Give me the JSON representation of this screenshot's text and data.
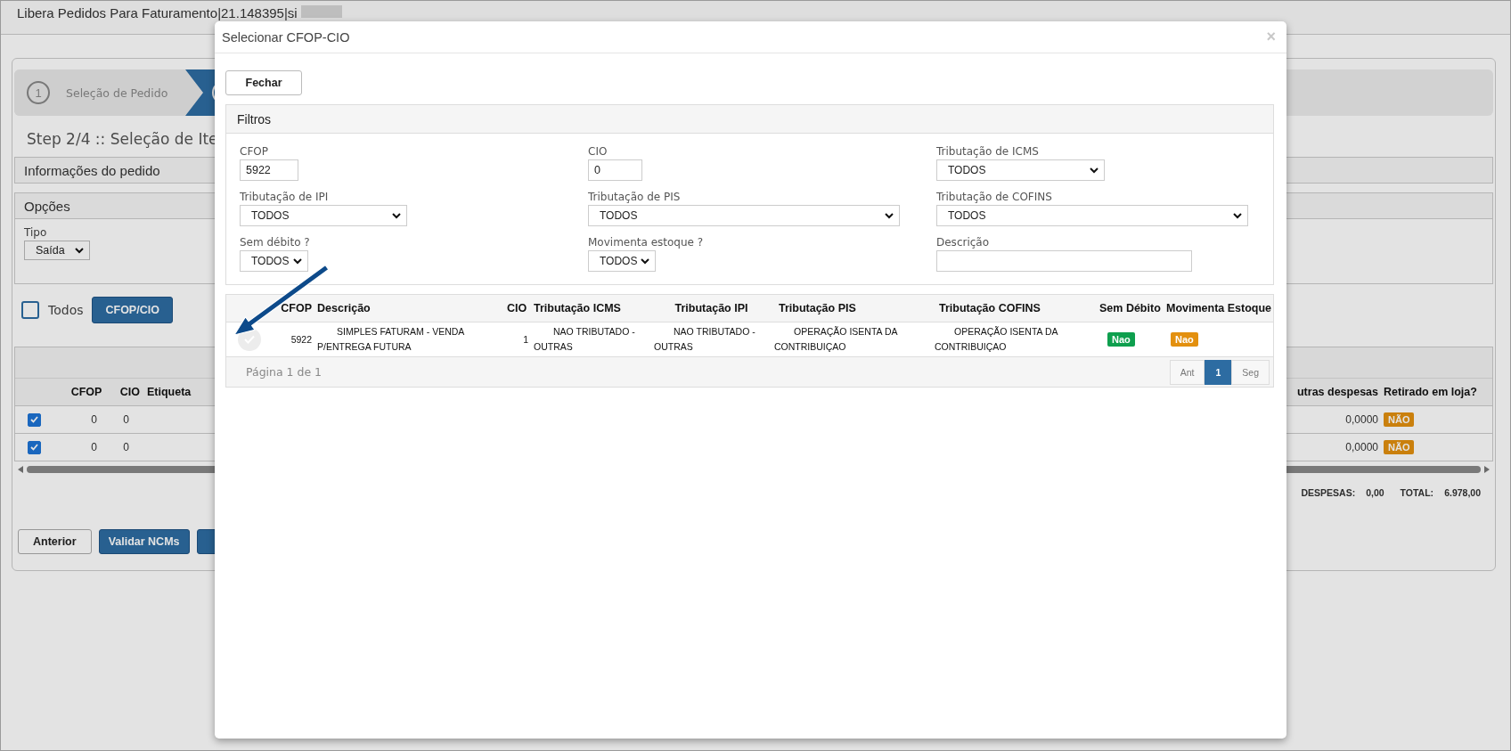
{
  "page": {
    "title": "Libera Pedidos Para Faturamento|21.148395|si"
  },
  "stepper": [
    {
      "number": "1",
      "label": "Seleção de Pedido",
      "selected": false
    },
    {
      "selected": true
    }
  ],
  "step_title": "Step 2/4 :: Seleção de Ite",
  "info_panel": {
    "title": "Informações do pedido"
  },
  "options_panel": {
    "title": "Opções",
    "tipo_label": "Tipo",
    "tipo_value": "Saída"
  },
  "select_all": {
    "label": "Todos",
    "checked": false
  },
  "cfop_button": "CFOP/CIO",
  "items_table": {
    "left_columns": [
      "CFOP",
      "CIO",
      "Etiqueta"
    ],
    "right_columns": [
      "utras despesas",
      "Retirado em loja?"
    ],
    "rows": [
      {
        "checked": true,
        "cfop": "0",
        "cio": "0",
        "outras_despesas": "0,0000",
        "retirado": "NÃO"
      },
      {
        "checked": true,
        "cfop": "0",
        "cio": "0",
        "outras_despesas": "0,0000",
        "retirado": "NÃO"
      }
    ]
  },
  "totals": [
    {
      "label": "DESPESAS:",
      "value": "0,00"
    },
    {
      "label": "TOTAL:",
      "value": "6.978,00"
    }
  ],
  "buttons": [
    {
      "label": "Anterior",
      "kind": "default"
    },
    {
      "label": "Validar NCMs",
      "kind": "primary"
    },
    {
      "kind": "primary"
    }
  ],
  "modal": {
    "title": "Selecionar CFOP-CIO",
    "close": "×",
    "close_button": "Fechar",
    "filters": {
      "title": "Filtros",
      "fields": [
        {
          "label": "CFOP",
          "kind": "input",
          "value": "5922"
        },
        {
          "label": "CIO",
          "kind": "input",
          "value": "0"
        },
        {
          "label": "Tributação de ICMS",
          "kind": "select",
          "value": "TODOS"
        },
        {
          "label": "Tributação de IPI",
          "kind": "select",
          "value": "TODOS"
        },
        {
          "label": "Tributação de PIS",
          "kind": "select",
          "value": "TODOS"
        },
        {
          "label": "Tributação de COFINS",
          "kind": "select",
          "value": "TODOS"
        },
        {
          "label": "Sem débito ?",
          "kind": "select",
          "value": "TODOS"
        },
        {
          "label": "Movimenta estoque ?",
          "kind": "select",
          "value": "TODOS"
        },
        {
          "label": "Descrição",
          "kind": "input"
        }
      ]
    },
    "table": {
      "columns": [
        "CFOP",
        "Descrição",
        "CIO",
        "Tributação ICMS",
        "Tributação IPI",
        "Tributação PIS",
        "Tributação COFINS",
        "Sem Débito",
        "Movimenta Estoque"
      ],
      "rows": [
        {
          "selected": false,
          "cfop": "5922",
          "descricao": "SIMPLES FATURAM - VENDA P/ENTREGA FUTURA",
          "cio": "1",
          "icms": "NAO TRIBUTADO - OUTRAS",
          "ipi": "NAO TRIBUTADO - OUTRAS",
          "pis": "OPERAÇÃO ISENTA DA CONTRIBUIÇAO",
          "cofins": "OPERAÇÃO ISENTA DA CONTRIBUIÇAO",
          "sem_debito": "Nao",
          "movimenta_estoque": "Nao"
        }
      ]
    },
    "pager": {
      "summary": "Página 1 de 1",
      "pages": [
        {
          "label": "Ant",
          "selected": false
        },
        {
          "label": "1",
          "selected": true
        },
        {
          "label": "Seg",
          "selected": false
        }
      ]
    }
  }
}
